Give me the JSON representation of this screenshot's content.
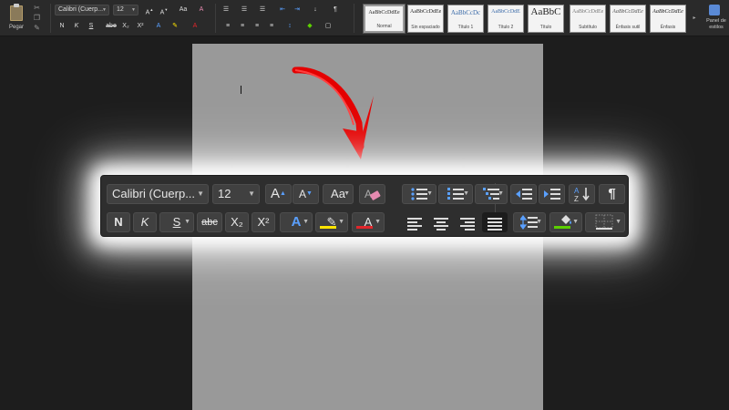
{
  "ribbon": {
    "paste_label": "Pegar",
    "font_name": "Calibri (Cuerp...",
    "font_size": "12",
    "bold": "N",
    "italic": "K",
    "underline": "S",
    "strike": "abe",
    "subscript": "X₂",
    "superscript": "X²",
    "styles": [
      {
        "sample": "AaBbCcDdEe",
        "name": "Normal"
      },
      {
        "sample": "AaBbCcDdEe",
        "name": "Sin espaciado"
      },
      {
        "sample": "AaBbCcDc",
        "name": "Título 1"
      },
      {
        "sample": "AaBbCcDdE",
        "name": "Título 2"
      },
      {
        "sample": "AaBbC",
        "name": "Título"
      },
      {
        "sample": "AaBbCcDdEe",
        "name": "Subtítulo"
      },
      {
        "sample": "AaBbCcDdEe",
        "name": "Énfasis sutil"
      },
      {
        "sample": "AaBbCcDdEe",
        "name": "Énfasis"
      }
    ],
    "styles_pane_label": "Panel de estilos"
  },
  "toolbar": {
    "font_name": "Calibri (Cuerp...",
    "font_size": "12",
    "grow_font": "A",
    "shrink_font": "A",
    "change_case": "Aa",
    "bold": "N",
    "italic": "K",
    "underline": "S",
    "strike": "abc",
    "subscript": "X₂",
    "superscript": "X²",
    "text_effects": "A",
    "font_color_letter": "A",
    "pilcrow": "¶",
    "colors": {
      "highlight": "#ffe400",
      "font_color": "#e0262b",
      "shading": "#5cd000",
      "accent": "#5aa0ff"
    }
  }
}
